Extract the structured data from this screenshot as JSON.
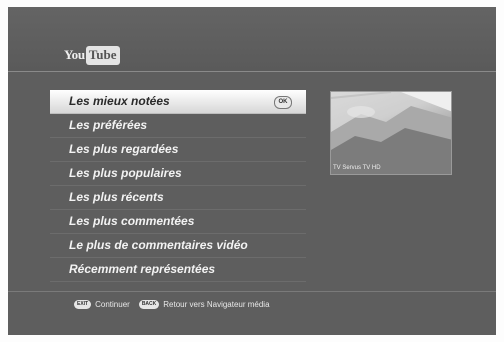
{
  "logo": {
    "you": "You",
    "tube": "Tube"
  },
  "menu": {
    "items": [
      {
        "label": "Les mieux notées",
        "selected": true
      },
      {
        "label": "Les préférées"
      },
      {
        "label": "Les plus regardées"
      },
      {
        "label": "Les plus populaires"
      },
      {
        "label": "Les plus récents"
      },
      {
        "label": "Les plus commentées"
      },
      {
        "label": "Le plus de commentaires vidéo"
      },
      {
        "label": "Récemment représentées"
      }
    ],
    "ok_badge": "OK"
  },
  "preview": {
    "caption": "TV   Servus TV HD"
  },
  "footer": {
    "exit_key": "EXIT",
    "exit_label": "Continuer",
    "back_key": "BACK",
    "back_label": "Retour vers Navigateur média"
  },
  "colors": {
    "background": "#5e5e5e",
    "selection": "#ffffff",
    "text": "#f3f3f3"
  }
}
